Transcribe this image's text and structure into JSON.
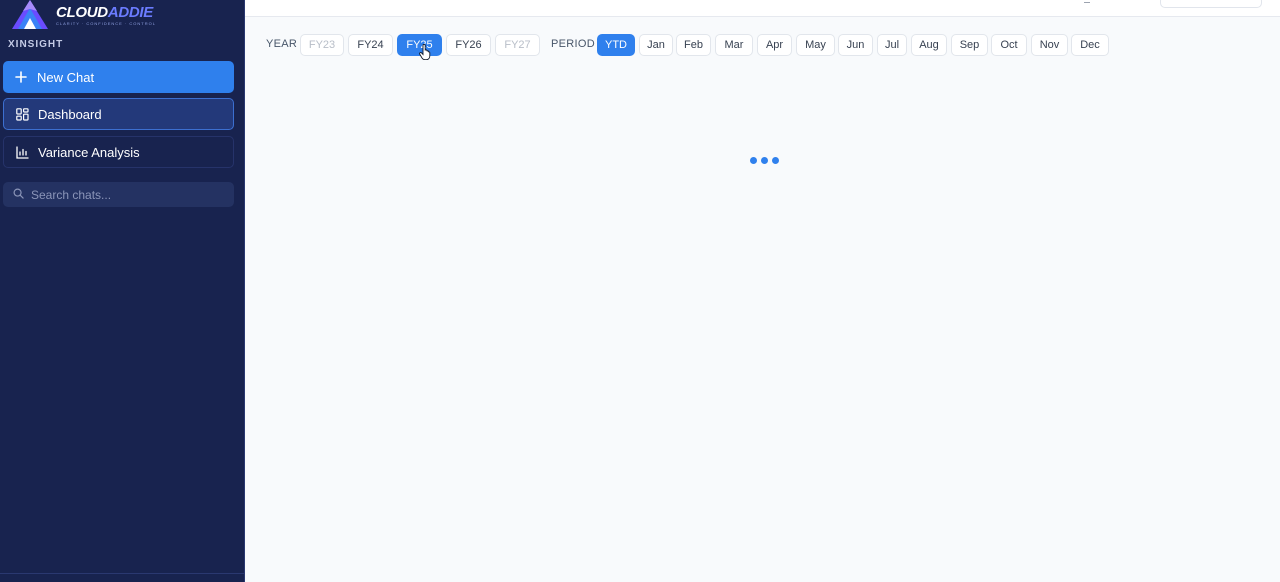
{
  "brand": {
    "name_part1": "CLOUD",
    "name_part2": "ADDIE",
    "tagline": "CLARITY · CONFIDENCE · CONTROL"
  },
  "sidebar": {
    "section_label": "XINSIGHT",
    "new_chat_label": "New Chat",
    "items": [
      {
        "label": "Dashboard",
        "icon": "grid-icon",
        "active": true
      },
      {
        "label": "Variance Analysis",
        "icon": "bar-chart-icon",
        "active": false
      }
    ],
    "search_placeholder": "Search chats..."
  },
  "filters": {
    "year_label": "YEAR",
    "years": [
      {
        "label": "FY23",
        "state": "disabled"
      },
      {
        "label": "FY24",
        "state": "normal"
      },
      {
        "label": "FY25",
        "state": "selected"
      },
      {
        "label": "FY26",
        "state": "normal"
      },
      {
        "label": "FY27",
        "state": "disabled"
      }
    ],
    "period_label": "PERIOD",
    "periods": [
      {
        "label": "YTD",
        "state": "selected"
      },
      {
        "label": "Jan",
        "state": "normal"
      },
      {
        "label": "Feb",
        "state": "normal"
      },
      {
        "label": "Mar",
        "state": "normal"
      },
      {
        "label": "Apr",
        "state": "normal"
      },
      {
        "label": "May",
        "state": "normal"
      },
      {
        "label": "Jun",
        "state": "normal"
      },
      {
        "label": "Jul",
        "state": "normal"
      },
      {
        "label": "Aug",
        "state": "normal"
      },
      {
        "label": "Sep",
        "state": "normal"
      },
      {
        "label": "Oct",
        "state": "normal"
      },
      {
        "label": "Nov",
        "state": "normal"
      },
      {
        "label": "Dec",
        "state": "normal"
      }
    ]
  },
  "colors": {
    "accent": "#2f80ed",
    "sidebar_bg": "#18234f",
    "main_bg": "#f8fafc"
  }
}
